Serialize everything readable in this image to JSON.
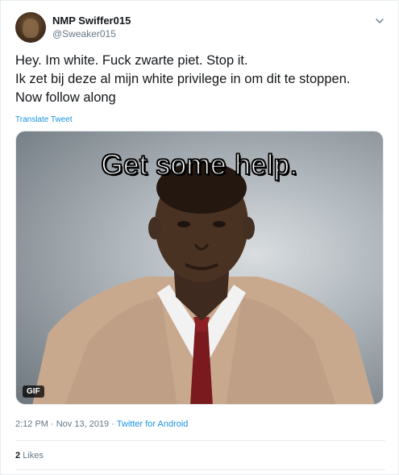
{
  "user": {
    "display_name": "NMP Swiffer015",
    "handle": "@Sweaker015"
  },
  "tweet": {
    "text": "Hey. Im white. Fuck zwarte piet. Stop it.\nIk zet bij deze al mijn white privilege in om dit te stoppen.\nNow follow along",
    "translate_label": "Translate Tweet"
  },
  "media": {
    "caption": "Get some help.",
    "badge": "GIF"
  },
  "meta": {
    "timestamp": "2:12 PM · Nov 13, 2019",
    "separator": " · ",
    "source": "Twitter for Android"
  },
  "stats": {
    "likes_count": "2",
    "likes_label": "Likes"
  },
  "icons": {
    "more": "chevron-down-icon"
  },
  "colors": {
    "link": "#1b95e0",
    "secondary_text": "#657786",
    "primary_text": "#14171a"
  }
}
